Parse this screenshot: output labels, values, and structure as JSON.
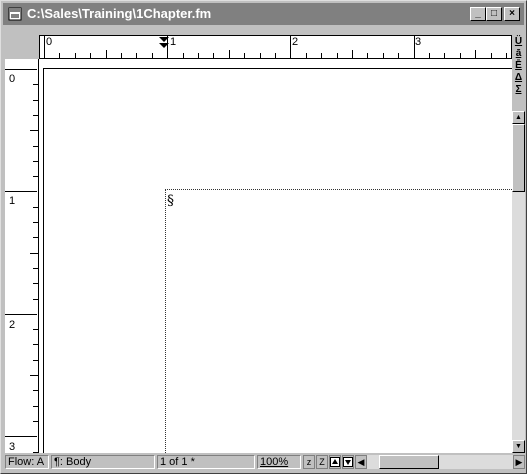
{
  "window": {
    "title": "C:\\Sales\\Training\\1Chapter.fm",
    "minimize_label": "_",
    "maximize_label": "□",
    "close_label": "×"
  },
  "ruler": {
    "h_labels": [
      "0",
      "1",
      "2",
      "3"
    ],
    "v_labels": [
      "0",
      "1",
      "2",
      "3"
    ]
  },
  "document": {
    "end_of_flow_mark": "§"
  },
  "right_tools": [
    "Ü",
    "ā",
    "Ē",
    "Δ",
    "Σ"
  ],
  "status": {
    "flow": "Flow: A",
    "tag": "¶: Body",
    "page": "1 of 1 *",
    "zoom": "100%",
    "z_small": "z",
    "z_large": "Z"
  },
  "colors": {
    "titlebar": "#808080",
    "chrome": "#c0c0c0",
    "page": "#ffffff"
  }
}
